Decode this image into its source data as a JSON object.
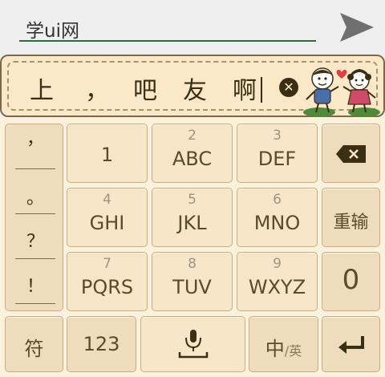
{
  "input": {
    "value": "学ui网"
  },
  "candidates": [
    "上",
    "，",
    "吧",
    "友",
    "啊"
  ],
  "clear_label": "✕",
  "punctuation": [
    "，",
    "。",
    "？",
    "！"
  ],
  "keys": {
    "k1": {
      "main": "1"
    },
    "k2": {
      "num": "2",
      "main": "ABC"
    },
    "k3": {
      "num": "3",
      "main": "DEF"
    },
    "k4": {
      "num": "4",
      "main": "GHI"
    },
    "k5": {
      "num": "5",
      "main": "JKL"
    },
    "k6": {
      "num": "6",
      "main": "MNO"
    },
    "k7": {
      "num": "7",
      "main": "PQRS"
    },
    "k8": {
      "num": "8",
      "main": "TUV"
    },
    "k9": {
      "num": "9",
      "main": "WXYZ"
    },
    "k0": {
      "main": "0"
    }
  },
  "retype_label": "重输",
  "symbol_label": "符",
  "numeric_label": "123",
  "lang_main": "中",
  "lang_sub": "/英",
  "colors": {
    "underline": "#2f6b3e",
    "key_bg": "#f8e6c8",
    "key_text": "#5a4b2a",
    "candidate_bg": "#fae8c8"
  }
}
